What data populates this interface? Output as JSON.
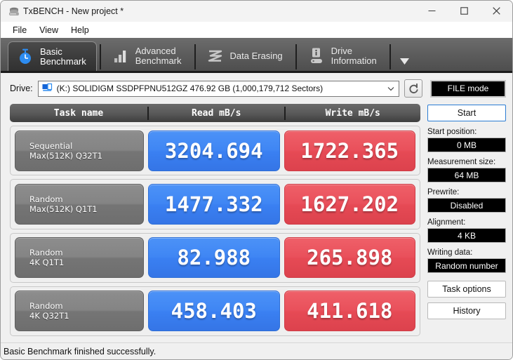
{
  "window": {
    "title": "TxBENCH - New project *",
    "app_icon": "hard-drive-icon",
    "minimize": "—",
    "maximize": "□",
    "close": "✕"
  },
  "menu": {
    "items": [
      {
        "label": "File"
      },
      {
        "label": "View"
      },
      {
        "label": "Help"
      }
    ]
  },
  "tabs": [
    {
      "label": "Basic\nBenchmark",
      "icon": "stopwatch-icon",
      "active": true
    },
    {
      "label": "Advanced\nBenchmark",
      "icon": "bar-chart-icon",
      "active": false
    },
    {
      "label": "Data Erasing",
      "icon": "eraser-wave-icon",
      "active": false
    },
    {
      "label": "Drive\nInformation",
      "icon": "drive-info-icon",
      "active": false
    }
  ],
  "tab_overflow_icon": "chevron-down-icon",
  "drive": {
    "label": "Drive:",
    "icon": "drive-icon",
    "selected": "(K:) SOLIDIGM SSDPFPNU512GZ  476.92 GB (1,000,179,712 Sectors)",
    "dropdown_icon": "chevron-down-icon",
    "refresh_icon": "refresh-icon",
    "mode_button": "FILE mode"
  },
  "table": {
    "headers": [
      "Task name",
      "Read mB/s",
      "Write mB/s"
    ],
    "rows": [
      {
        "task": "Sequential\nMax(512K) Q32T1",
        "read": "3204.694",
        "write": "1722.365"
      },
      {
        "task": "Random\nMax(512K) Q1T1",
        "read": "1477.332",
        "write": "1627.202"
      },
      {
        "task": "Random\n4K Q1T1",
        "read": "82.988",
        "write": "265.898"
      },
      {
        "task": "Random\n4K Q32T1",
        "read": "458.403",
        "write": "411.618"
      }
    ]
  },
  "sidebar": {
    "start_button": "Start",
    "fields": [
      {
        "label": "Start position:",
        "value": "0 MB"
      },
      {
        "label": "Measurement size:",
        "value": "64 MB"
      },
      {
        "label": "Prewrite:",
        "value": "Disabled"
      },
      {
        "label": "Alignment:",
        "value": "4 KB"
      },
      {
        "label": "Writing data:",
        "value": "Random number"
      }
    ],
    "buttons": [
      {
        "label": "Task options"
      },
      {
        "label": "History"
      }
    ]
  },
  "status": {
    "message": "Basic Benchmark finished successfully."
  },
  "colors": {
    "read": "#3a80f2",
    "write": "#e64a55",
    "task": "#808080",
    "accent": "#2b7cd3"
  }
}
